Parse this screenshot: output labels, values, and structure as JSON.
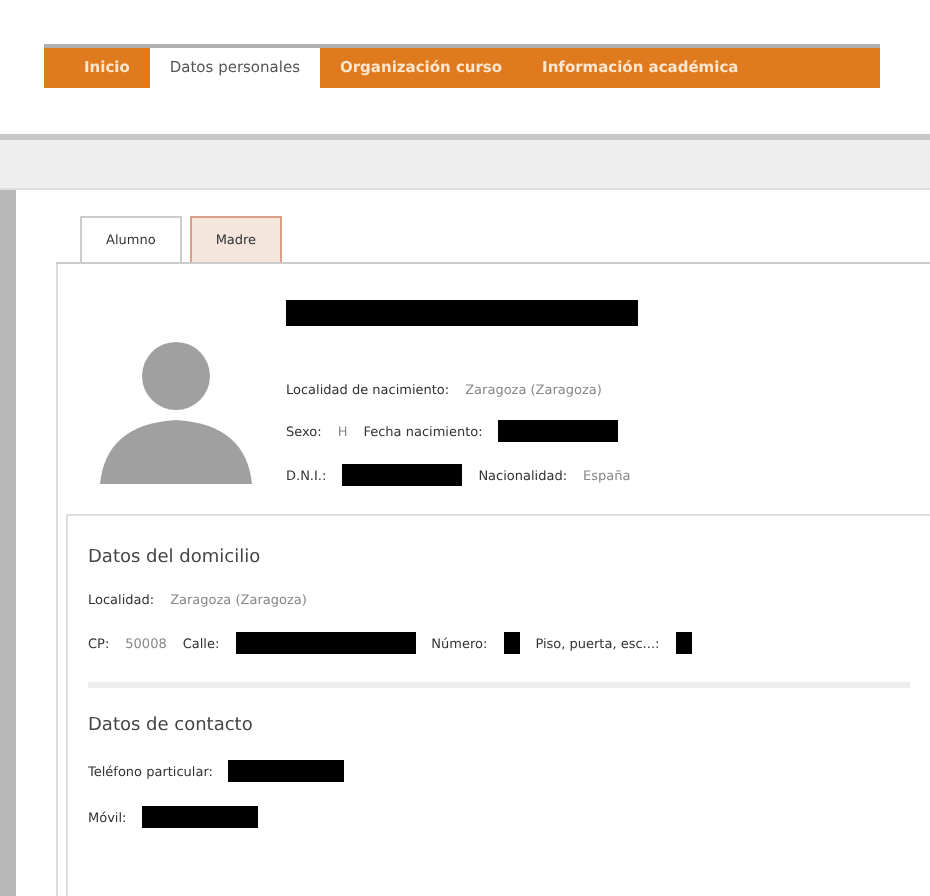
{
  "menu": [
    {
      "label": "Inicio",
      "selected": false
    },
    {
      "label": "Datos personales",
      "selected": true
    },
    {
      "label": "Organización curso",
      "selected": false
    },
    {
      "label": "Información académica",
      "selected": false
    }
  ],
  "subtabs": [
    {
      "label": "Alumno",
      "selected": true
    },
    {
      "label": "Madre",
      "selected": false
    }
  ],
  "student": {
    "name_redacted": true,
    "rows": [
      [
        {
          "label": "Localidad de nacimiento:",
          "value": "Zaragoza (Zaragoza)"
        }
      ],
      [
        {
          "label": "Sexo:",
          "value": "H"
        },
        {
          "label": "Fecha nacimiento:",
          "redacted": true
        }
      ],
      [
        {
          "label": "D.N.I.:",
          "redacted": true
        },
        {
          "label": "Nacionalidad:",
          "value": "España"
        }
      ]
    ]
  },
  "sections": [
    {
      "title": "Datos del domicilio",
      "rows": [
        [
          {
            "label": "Localidad:",
            "value": "Zaragoza (Zaragoza)"
          }
        ],
        [
          {
            "label": "CP:",
            "value": "50008"
          },
          {
            "label": "Calle:",
            "redacted": true
          },
          {
            "label": "Número:",
            "redacted": true
          },
          {
            "label": "Piso, puerta, esc...:",
            "redacted": true
          }
        ]
      ]
    },
    {
      "title": "Datos de contacto",
      "rows": [
        [
          {
            "label": "Teléfono particular:",
            "redacted": true
          }
        ],
        [
          {
            "label": "Móvil:",
            "redacted": true
          }
        ]
      ]
    }
  ]
}
